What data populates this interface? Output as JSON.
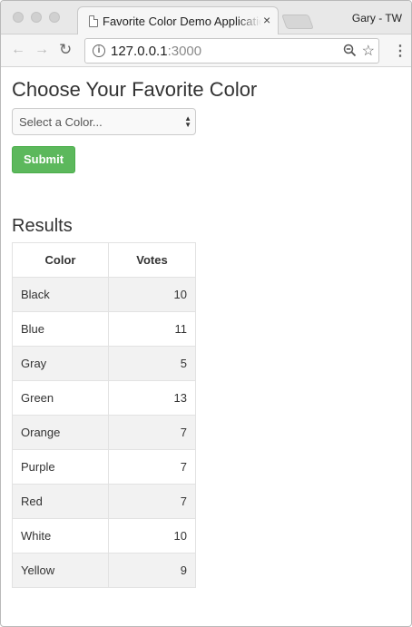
{
  "browser": {
    "tab_title": "Favorite Color Demo Application",
    "tab_close": "×",
    "profile_name": "Gary - TW",
    "url_host": "127.0.0.1",
    "url_port": ":3000",
    "icons": {
      "back": "arrow-left-icon",
      "forward": "arrow-right-icon",
      "reload": "reload-icon",
      "info": "info-icon",
      "zoom": "zoom-out-icon",
      "bookmark": "star-icon",
      "menu": "kebab-menu-icon"
    }
  },
  "page": {
    "heading": "Choose Your Favorite Color",
    "select_placeholder": "Select a Color...",
    "submit_label": "Submit",
    "results_heading": "Results"
  },
  "table": {
    "headers": [
      "Color",
      "Votes"
    ],
    "rows": [
      {
        "color": "Black",
        "votes": "10"
      },
      {
        "color": "Blue",
        "votes": "11"
      },
      {
        "color": "Gray",
        "votes": "5"
      },
      {
        "color": "Green",
        "votes": "13"
      },
      {
        "color": "Orange",
        "votes": "7"
      },
      {
        "color": "Purple",
        "votes": "7"
      },
      {
        "color": "Red",
        "votes": "7"
      },
      {
        "color": "White",
        "votes": "10"
      },
      {
        "color": "Yellow",
        "votes": "9"
      }
    ]
  },
  "colors": {
    "submit_bg": "#5cb85c",
    "row_stripe": "#f2f2f2"
  }
}
